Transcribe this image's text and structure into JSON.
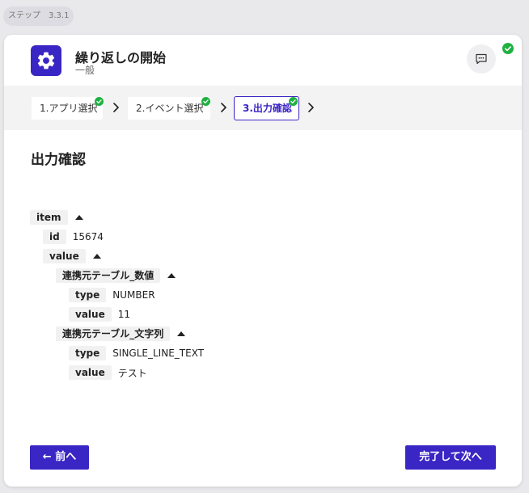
{
  "step_chip": "ステップ　3.3.1",
  "header": {
    "title": "繰り返しの開始",
    "subtitle": "一般"
  },
  "stepper": {
    "steps": [
      {
        "label": "1.アプリ選択",
        "done": true
      },
      {
        "label": "2.イベント選択",
        "done": true
      },
      {
        "label": "3.出力確認",
        "done": true,
        "active": true
      }
    ]
  },
  "section_title": "出力確認",
  "tree": {
    "item_key": "item",
    "id_key": "id",
    "id_value": "15674",
    "value_key": "value",
    "field1_key": "連携元テーブル_数値",
    "field1_type_key": "type",
    "field1_type_value": "NUMBER",
    "field1_value_key": "value",
    "field1_value_value": "11",
    "field2_key": "連携元テーブル_文字列",
    "field2_type_key": "type",
    "field2_type_value": "SINGLE_LINE_TEXT",
    "field2_value_key": "value",
    "field2_value_value": "テスト"
  },
  "footer": {
    "prev_label": "← 前へ",
    "next_label": "完了して次へ"
  },
  "colors": {
    "accent": "#3a26c4",
    "success": "#1fb141",
    "background": "#e9e9ec"
  },
  "icons": {
    "app": "gear-icon",
    "comment": "comment-icon",
    "status": "check-circle-icon",
    "step_separator": "chevron-right-icon",
    "tree_toggle": "caret-up-icon"
  }
}
